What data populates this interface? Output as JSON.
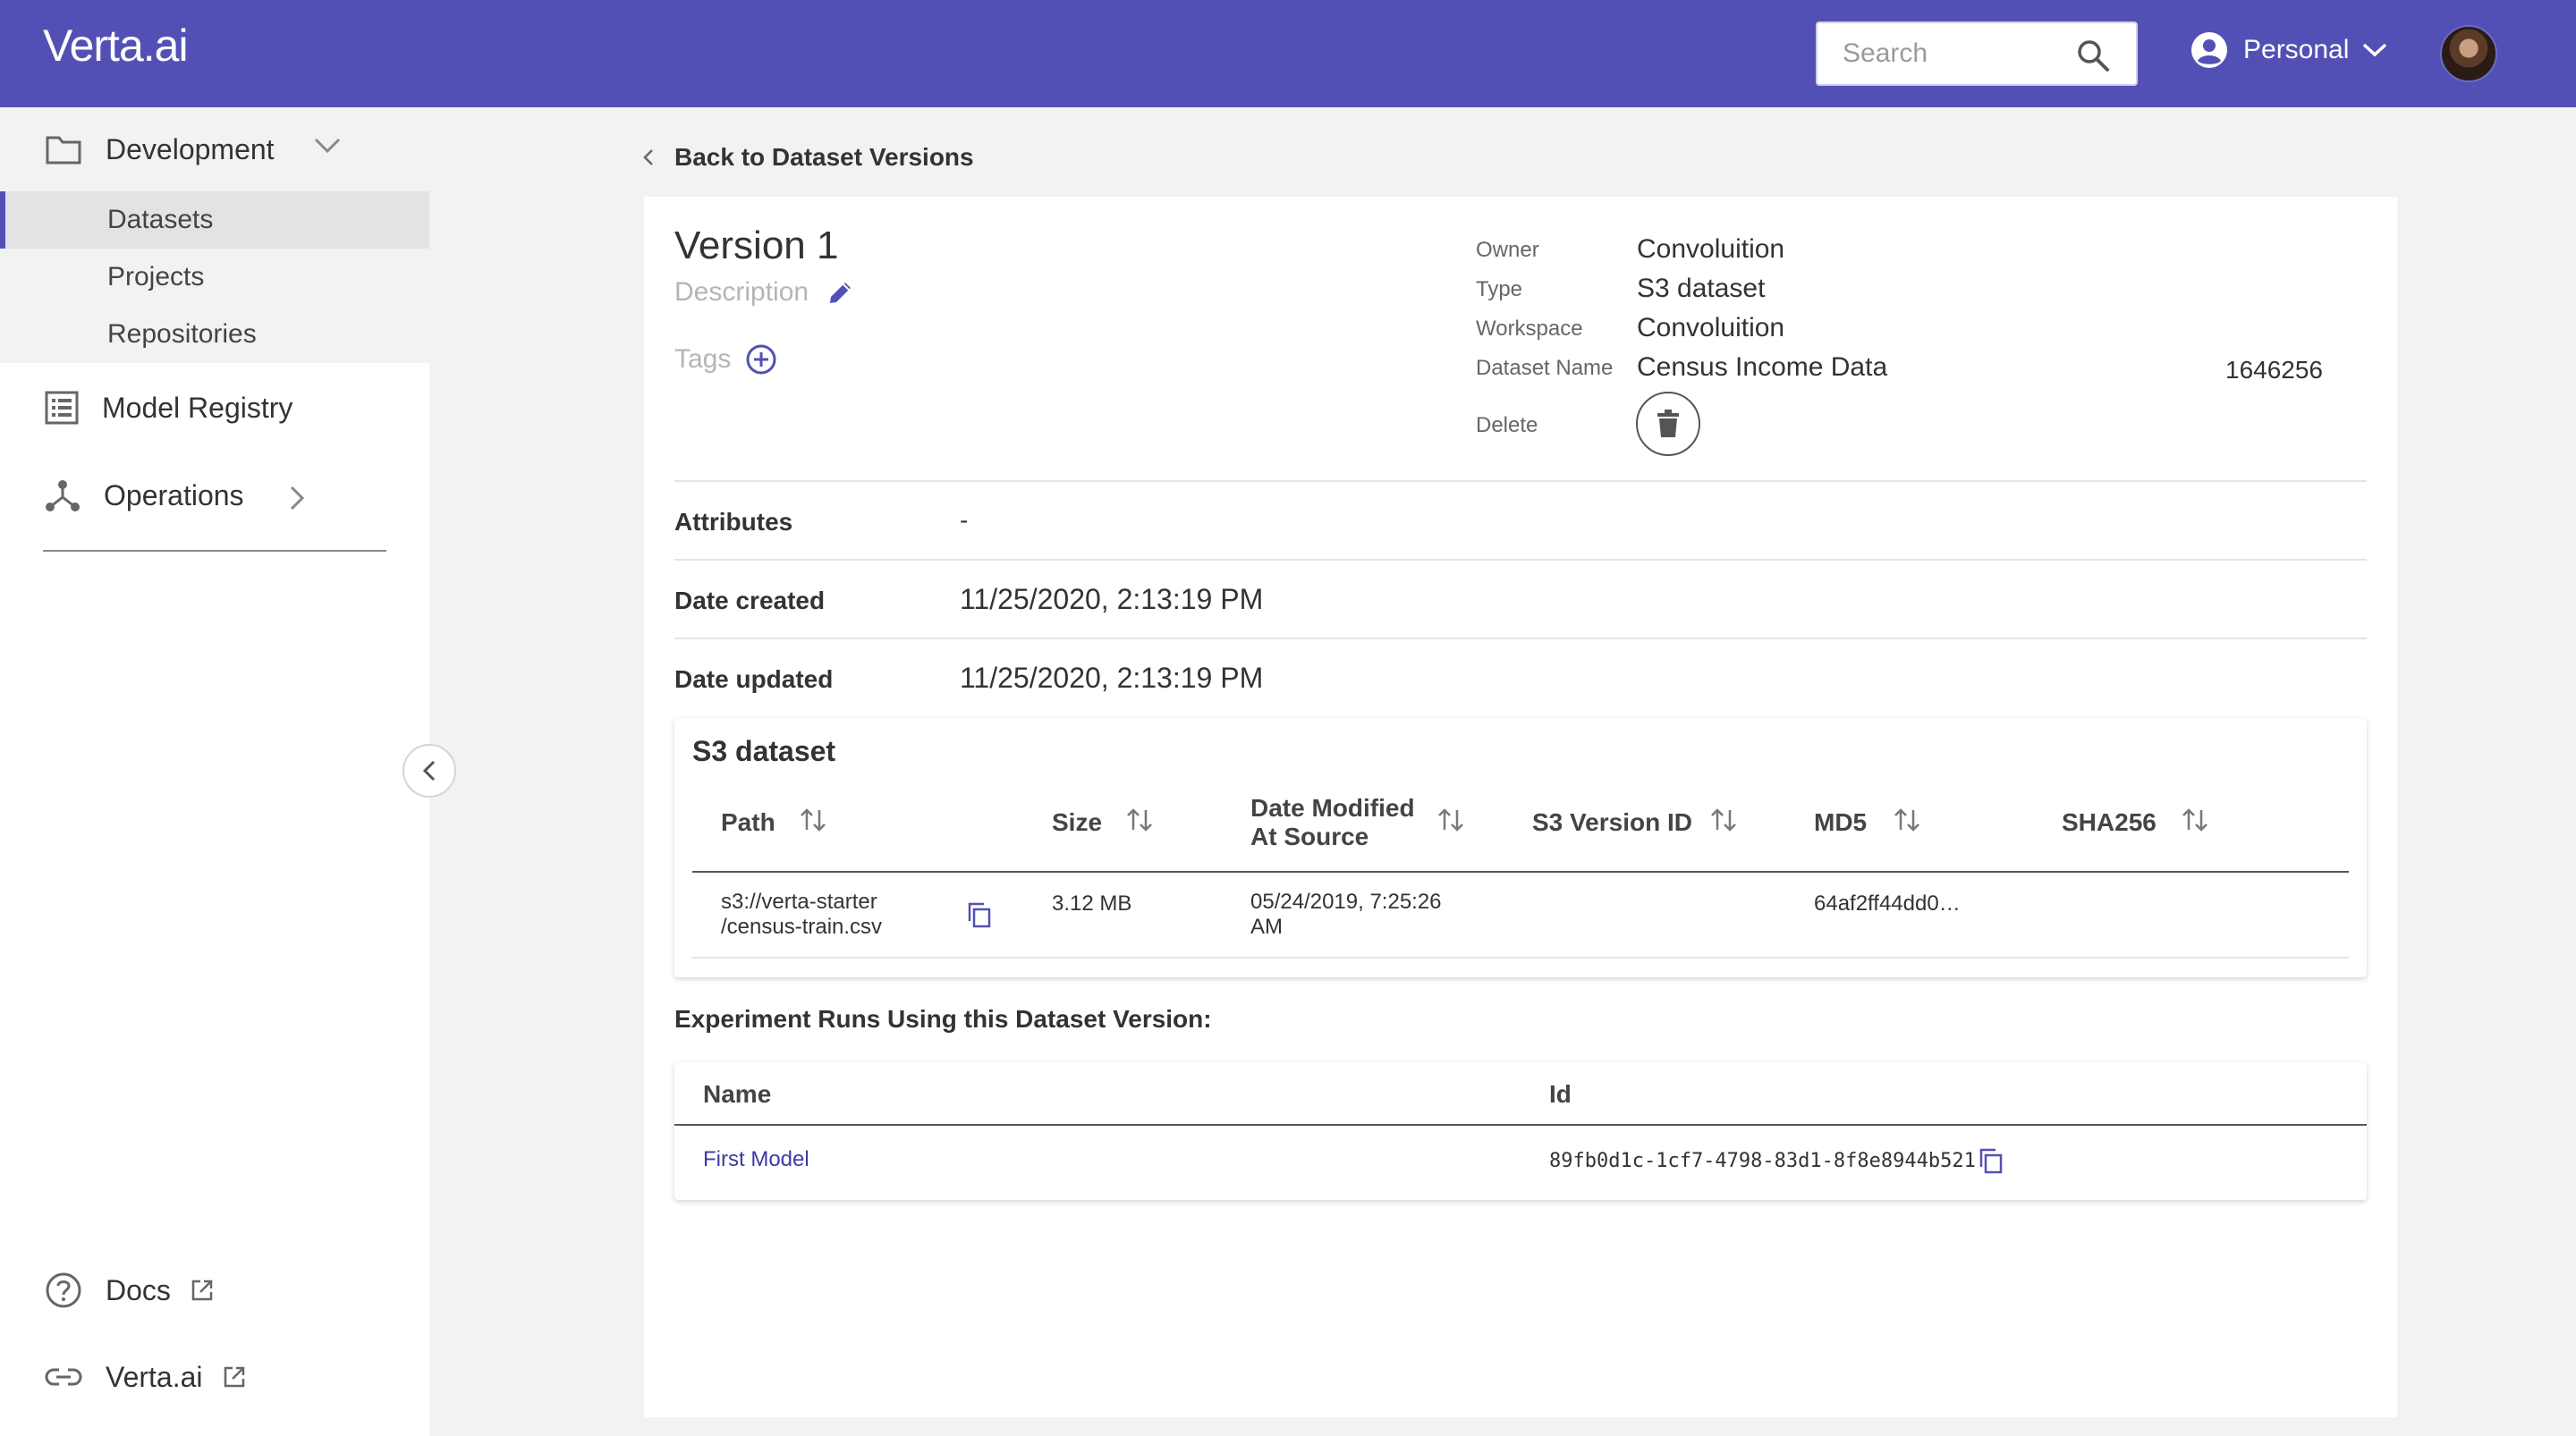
{
  "header": {
    "logo": "Verta.ai",
    "search_placeholder": "Search",
    "workspace": "Personal",
    "brand_color": "#5350b5"
  },
  "sidebar": {
    "development": {
      "label": "Development",
      "items": [
        {
          "label": "Datasets",
          "active": true
        },
        {
          "label": "Projects"
        },
        {
          "label": "Repositories"
        }
      ]
    },
    "model_registry": "Model Registry",
    "operations": "Operations",
    "footer": [
      {
        "label": "Docs",
        "icon": "help-circle-icon"
      },
      {
        "label": "Verta.ai",
        "icon": "link-icon"
      }
    ]
  },
  "page": {
    "back_label": "Back to Dataset Versions",
    "title": "Version 1",
    "description_placeholder": "Description",
    "tags_label": "Tags",
    "meta": {
      "owner_label": "Owner",
      "owner": "Convoluition",
      "type_label": "Type",
      "type": "S3 dataset",
      "workspace_label": "Workspace",
      "workspace": "Convoluition",
      "dataset_name_label": "Dataset Name",
      "dataset_name": "Census Income Data",
      "dataset_id": "1646256",
      "delete_label": "Delete"
    },
    "attributes_label": "Attributes",
    "attributes_value": "-",
    "date_created_label": "Date created",
    "date_created": "11/25/2020, 2:13:19 PM",
    "date_updated_label": "Date updated",
    "date_updated": "11/25/2020, 2:13:19 PM"
  },
  "s3": {
    "title": "S3 dataset",
    "columns": {
      "path": "Path",
      "size": "Size",
      "date_modified_1": "Date Modified",
      "date_modified_2": "At Source",
      "version_id": "S3 Version ID",
      "md5": "MD5",
      "sha256": "SHA256"
    },
    "rows": [
      {
        "path_1": "s3://verta-starter",
        "path_2": "/census-train.csv",
        "size": "3.12 MB",
        "date_1": "05/24/2019, 7:25:26",
        "date_2": "AM",
        "version_id": "",
        "md5": "64af2ff44dd0…",
        "sha256": ""
      }
    ]
  },
  "runs": {
    "title": "Experiment Runs Using this Dataset Version:",
    "columns": {
      "name": "Name",
      "id": "Id"
    },
    "rows": [
      {
        "name": "First Model",
        "id": "89fb0d1c-1cf7-4798-83d1-8f8e8944b521"
      }
    ]
  }
}
